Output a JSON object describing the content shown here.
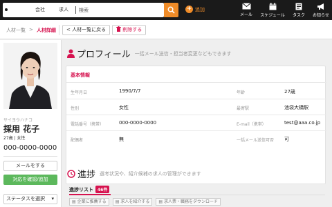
{
  "header": {
    "filters": [
      {
        "label": "人材",
        "checked": true
      },
      {
        "label": "会社",
        "checked": false
      },
      {
        "label": "求人",
        "checked": false
      }
    ],
    "search_placeholder": "検索",
    "add_label": "追加",
    "nav": [
      {
        "label": "メール",
        "icon": "mail-icon"
      },
      {
        "label": "スケジュール",
        "icon": "calendar-icon"
      },
      {
        "label": "タスク",
        "icon": "task-icon"
      },
      {
        "label": "お知らせ",
        "icon": "megaphone-icon"
      }
    ],
    "accent_color": "#f08c28"
  },
  "subbar": {
    "breadcrumb": [
      "人材一覧",
      ">",
      "人材詳細"
    ],
    "back_label": "< 人材一覧に戻る",
    "delete_label": "削除する"
  },
  "profile_card": {
    "kana": "サイヨウハナコ",
    "name": "採用 花子",
    "age_sex": "27歳 | 女性",
    "phone": "000-0000-0000",
    "mail_button": "メールをする",
    "confirm_button": "対応を確認/追加",
    "status_select": "ステータスを選択"
  },
  "profile_section": {
    "title": "プロフィール",
    "subtitle": "一括メール送信・担当者変更などもできます",
    "card_title": "基本情報",
    "rows": [
      {
        "l1": "生年月日",
        "v1": "1990/7/7",
        "l2": "年齢",
        "v2": "27歳"
      },
      {
        "l1": "性別",
        "v1": "女性",
        "l2": "最寄駅",
        "v2": "池袋大橋駅"
      },
      {
        "l1": "電話番号（携帯）",
        "v1": "000-0000-0000",
        "l2": "E-mail（携帯）",
        "v2": "test@aaa.co.jp"
      },
      {
        "l1": "配偶者",
        "v1": "無",
        "l2": "一括メール送信可否",
        "v2": "可"
      }
    ]
  },
  "progress_section": {
    "title": "進捗",
    "subtitle": "選考状況や、紹介候補の求人の管理ができます",
    "list_label": "進捗リスト",
    "count": "46件",
    "actions": [
      "企業に推薦する",
      "求人を紹介する",
      "求人票・職務をダウンロード"
    ]
  },
  "brand_color": "#d6134f"
}
